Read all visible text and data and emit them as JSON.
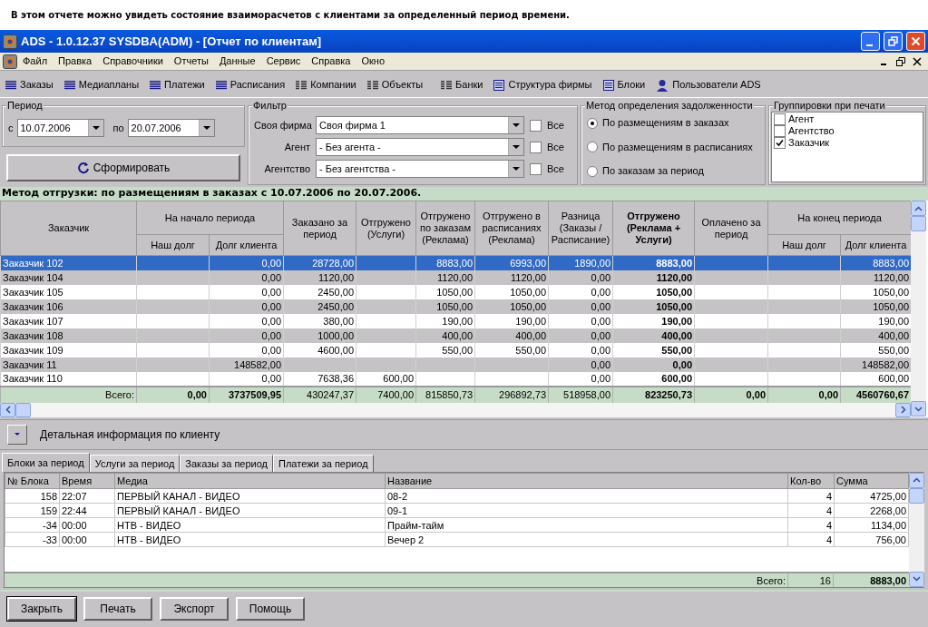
{
  "caption": "В этом отчете можно увидеть состояние взаиморасчетов с клиентами за определенный период времени.",
  "window": {
    "title": "ADS - 1.0.12.37 SYSDBA(ADM) - [Отчет по клиентам]"
  },
  "menu": [
    "Файл",
    "Правка",
    "Справочники",
    "Отчеты",
    "Данные",
    "Сервис",
    "Справка",
    "Окно"
  ],
  "toolbar": [
    "Заказы",
    "Медиапланы",
    "Платежи",
    "Расписания",
    "Компании",
    "Объекты",
    "Банки",
    "Структура фирмы",
    "Блоки",
    "Пользователи ADS"
  ],
  "period": {
    "title": "Период",
    "from_label": "с",
    "from": "10.07.2006",
    "to_label": "по",
    "to": "20.07.2006"
  },
  "build_button": "Сформировать",
  "filter": {
    "title": "Фильтр",
    "rows": [
      {
        "label": "Своя фирма",
        "value": "Своя фирма 1",
        "all_label": "Все",
        "all_checked": false
      },
      {
        "label": "Агент",
        "value": "- Без агента -",
        "all_label": "Все",
        "all_checked": false
      },
      {
        "label": "Агентство",
        "value": "- Без агентства -",
        "all_label": "Все",
        "all_checked": false
      }
    ]
  },
  "debt_method": {
    "title": "Метод определения задолженности",
    "options": [
      {
        "label": "По размещениям в заказах",
        "selected": true
      },
      {
        "label": "По размещениям в расписаниях",
        "selected": false
      },
      {
        "label": "По заказам за период",
        "selected": false
      }
    ]
  },
  "print_grouping": {
    "title": "Группировки при печати",
    "items": [
      {
        "label": "Агент",
        "checked": false
      },
      {
        "label": "Агентство",
        "checked": false
      },
      {
        "label": "Заказчик",
        "checked": true
      }
    ]
  },
  "method_line": "Метод отгрузки: по размещениям в заказах с 10.07.2006 по 20.07.2006.",
  "table": {
    "header_rows": [
      {
        "cells": [
          {
            "label": "Заказчик",
            "rowspan": 2,
            "bold": false
          },
          {
            "label": "На начало периода",
            "colspan": 2,
            "bold": false
          },
          {
            "label": "Заказано за период",
            "rowspan": 2,
            "bold": false
          },
          {
            "label": "Отгружено (Услуги)",
            "rowspan": 2,
            "bold": false
          },
          {
            "label": "Отгружено по заказам (Реклама)",
            "rowspan": 2,
            "bold": false
          },
          {
            "label": "Отгружено в расписаниях (Реклама)",
            "rowspan": 2,
            "bold": false
          },
          {
            "label": "Разница (Заказы / Расписание)",
            "rowspan": 2,
            "bold": false
          },
          {
            "label": "Отгружено (Реклама + Услуги)",
            "rowspan": 2,
            "bold": true
          },
          {
            "label": "Оплачено за период",
            "rowspan": 2,
            "bold": false
          },
          {
            "label": "На конец периода",
            "colspan": 2,
            "bold": false
          }
        ]
      },
      {
        "cells": [
          {
            "label": "Наш долг",
            "bold": false
          },
          {
            "label": "Долг клиента",
            "bold": false
          },
          {
            "label": "Наш долг",
            "bold": false
          },
          {
            "label": "Долг клиента",
            "bold": false
          }
        ]
      }
    ],
    "rows": [
      {
        "selected": true,
        "cells": [
          "Заказчик 102",
          null,
          "0,00",
          "28728,00",
          null,
          "8883,00",
          "6993,00",
          "1890,00",
          "8883,00",
          null,
          null,
          "8883,00"
        ]
      },
      {
        "selected": false,
        "cells": [
          "Заказчик 104",
          null,
          "0,00",
          "1120,00",
          null,
          "1120,00",
          "1120,00",
          "0,00",
          "1120,00",
          null,
          null,
          "1120,00"
        ]
      },
      {
        "selected": false,
        "cells": [
          "Заказчик 105",
          null,
          "0,00",
          "2450,00",
          null,
          "1050,00",
          "1050,00",
          "0,00",
          "1050,00",
          null,
          null,
          "1050,00"
        ]
      },
      {
        "selected": false,
        "cells": [
          "Заказчик 106",
          null,
          "0,00",
          "2450,00",
          null,
          "1050,00",
          "1050,00",
          "0,00",
          "1050,00",
          null,
          null,
          "1050,00"
        ]
      },
      {
        "selected": false,
        "cells": [
          "Заказчик 107",
          null,
          "0,00",
          "380,00",
          null,
          "190,00",
          "190,00",
          "0,00",
          "190,00",
          null,
          null,
          "190,00"
        ]
      },
      {
        "selected": false,
        "cells": [
          "Заказчик 108",
          null,
          "0,00",
          "1000,00",
          null,
          "400,00",
          "400,00",
          "0,00",
          "400,00",
          null,
          null,
          "400,00"
        ]
      },
      {
        "selected": false,
        "cells": [
          "Заказчик 109",
          null,
          "0,00",
          "4600,00",
          null,
          "550,00",
          "550,00",
          "0,00",
          "550,00",
          null,
          null,
          "550,00"
        ]
      },
      {
        "selected": false,
        "cells": [
          "Заказчик 11",
          null,
          "148582,00",
          null,
          null,
          null,
          null,
          "0,00",
          "0,00",
          null,
          null,
          "148582,00"
        ]
      },
      {
        "selected": false,
        "cells": [
          "Заказчик 110",
          null,
          "0,00",
          "7638,36",
          "600,00",
          null,
          null,
          "0,00",
          "600,00",
          null,
          null,
          "600,00"
        ]
      }
    ],
    "totals": [
      {
        "text": "Всего:",
        "bold": false
      },
      {
        "text": "0,00",
        "bold": true
      },
      {
        "text": "3737509,95",
        "bold": true
      },
      {
        "text": "430247,37",
        "bold": false
      },
      {
        "text": "7400,00",
        "bold": false
      },
      {
        "text": "815850,73",
        "bold": false
      },
      {
        "text": "296892,73",
        "bold": false
      },
      {
        "text": "518958,00",
        "bold": false
      },
      {
        "text": "823250,73",
        "bold": true
      },
      {
        "text": "0,00",
        "bold": true
      },
      {
        "text": "0,00",
        "bold": true
      },
      {
        "text": "4560760,67",
        "bold": true
      }
    ]
  },
  "detail": {
    "label": "Детальная информация по клиенту"
  },
  "tabs": [
    {
      "label": "Блоки за период",
      "selected": true
    },
    {
      "label": "Услуги за период",
      "selected": false
    },
    {
      "label": "Заказы за период",
      "selected": false
    },
    {
      "label": "Платежи за период",
      "selected": false
    }
  ],
  "blocks": {
    "columns": [
      "№ Блока",
      "Время",
      "Медиа",
      "Название",
      "Кол-во",
      "Сумма"
    ],
    "rows": [
      [
        "158",
        "22:07",
        "ПЕРВЫЙ КАНАЛ - ВИДЕО",
        "08-2",
        "4",
        "4725,00"
      ],
      [
        "159",
        "22:44",
        "ПЕРВЫЙ КАНАЛ - ВИДЕО",
        "09-1",
        "4",
        "2268,00"
      ],
      [
        "-34",
        "00:00",
        "НТВ - ВИДЕО",
        "Прайм-тайм",
        "4",
        "1134,00"
      ],
      [
        "-33",
        "00:00",
        "НТВ - ВИДЕО",
        "Вечер 2",
        "4",
        "756,00"
      ]
    ],
    "totals": {
      "label": "Всего:",
      "count": "16",
      "sum": "8883,00"
    }
  },
  "buttons": [
    "Закрыть",
    "Печать",
    "Экспорт",
    "Помощь"
  ]
}
